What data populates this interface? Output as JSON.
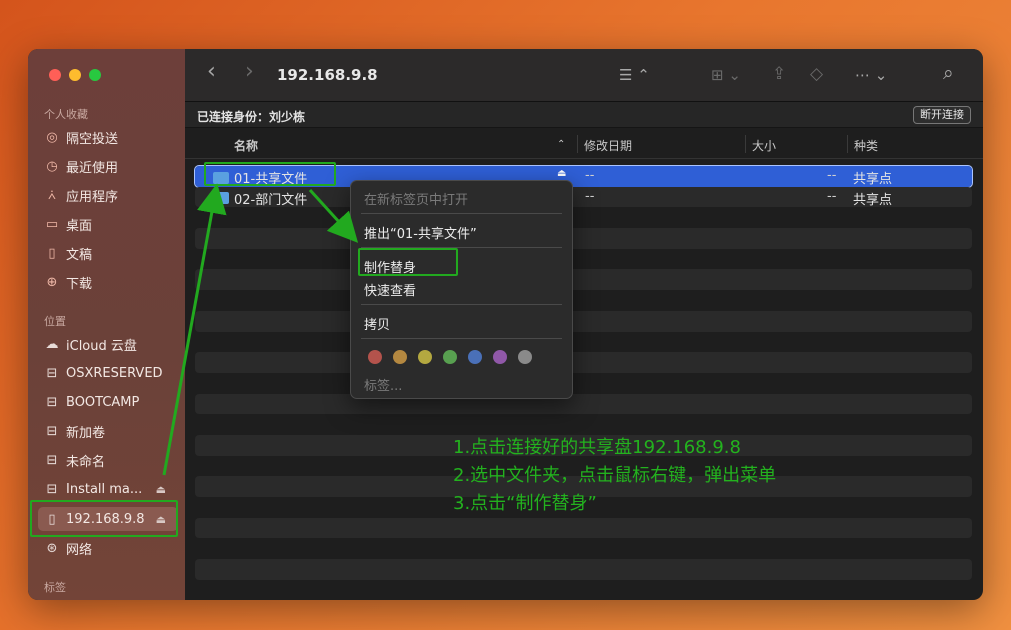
{
  "sidebar": {
    "favorites_header": "个人收藏",
    "favorites": [
      {
        "label": "隔空投送",
        "icon": "airdrop-icon"
      },
      {
        "label": "最近使用",
        "icon": "clock-icon"
      },
      {
        "label": "应用程序",
        "icon": "applications-icon"
      },
      {
        "label": "桌面",
        "icon": "desktop-icon"
      },
      {
        "label": "文稿",
        "icon": "document-icon"
      },
      {
        "label": "下载",
        "icon": "download-icon"
      }
    ],
    "locations_header": "位置",
    "locations": [
      {
        "label": "iCloud 云盘",
        "icon": "cloud-icon"
      },
      {
        "label": "OSXRESERVED",
        "icon": "drive-icon"
      },
      {
        "label": "BOOTCAMP",
        "icon": "drive-icon"
      },
      {
        "label": "新加卷",
        "icon": "drive-icon"
      },
      {
        "label": "未命名",
        "icon": "drive-icon"
      },
      {
        "label": "Install ma...",
        "icon": "drive-icon",
        "eject": "⏏"
      },
      {
        "label": "192.168.9.8",
        "icon": "server-doc-icon",
        "eject": "⏏"
      },
      {
        "label": "网络",
        "icon": "network-icon"
      }
    ],
    "tags_header": "标签"
  },
  "toolbar": {
    "title": "192.168.9.8",
    "back": "‹",
    "forward": "›",
    "list_view": "☰ ⌃",
    "grid_view": "⊞ ⌄",
    "share": "⇪",
    "tag": "◇",
    "more": "⋯ ⌄",
    "search": "⌕"
  },
  "subbar": {
    "connected_as": "已连接身份：刘少栋",
    "disconnect": "断开连接"
  },
  "columns": {
    "name": "名称",
    "date": "修改日期",
    "size": "大小",
    "kind": "种类"
  },
  "files": [
    {
      "name": "01-共享文件",
      "date": "--",
      "size": "--",
      "kind": "共享点",
      "selected": true
    },
    {
      "name": "02-部门文件",
      "date": "--",
      "size": "--",
      "kind": "共享点",
      "selected": false
    }
  ],
  "context_menu": {
    "open_new_tab": "在新标签页中打开",
    "eject": "推出“01-共享文件”",
    "make_alias": "制作替身",
    "quick_look": "快速查看",
    "copy": "拷贝",
    "tags_label": "标签...",
    "tag_colors": [
      "#b4534c",
      "#b48840",
      "#b4a840",
      "#58a050",
      "#4a70b8",
      "#9058a8",
      "#8a8a8a"
    ]
  },
  "annotations": {
    "step1": "1.点击连接好的共享盘192.168.9.8",
    "step2": "2.选中文件夹，点击鼠标右键，弹出菜单",
    "step3": "3.点击“制作替身”",
    "color": "#22a91f"
  }
}
